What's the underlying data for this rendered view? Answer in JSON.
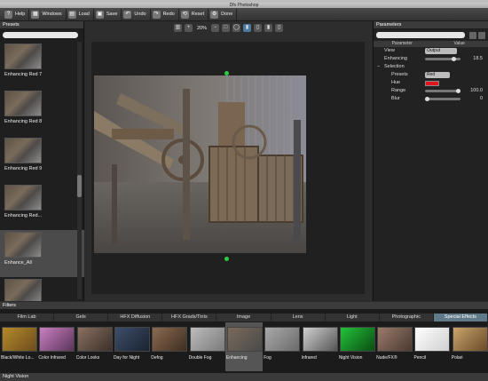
{
  "window": {
    "title": "Dfx Photoshop"
  },
  "toolbar": {
    "buttons": [
      {
        "name": "help-button",
        "icon": "question-icon",
        "glyph": "?",
        "label": "Help"
      },
      {
        "name": "windows-button",
        "icon": "windows-icon",
        "glyph": "▦",
        "label": "Windows"
      },
      {
        "name": "load-button",
        "icon": "folder-icon",
        "glyph": "▤",
        "label": "Load"
      },
      {
        "name": "save-button",
        "icon": "disk-icon",
        "glyph": "▣",
        "label": "Save"
      },
      {
        "name": "undo-button",
        "icon": "undo-icon",
        "glyph": "↶",
        "label": "Undo"
      },
      {
        "name": "redo-button",
        "icon": "redo-icon",
        "glyph": "↷",
        "label": "Redo"
      },
      {
        "name": "reset-button",
        "icon": "reset-icon",
        "glyph": "⟲",
        "label": "Reset"
      },
      {
        "name": "done-button",
        "icon": "gear-icon",
        "glyph": "⚙",
        "label": "Done"
      }
    ]
  },
  "presets": {
    "title": "Presets",
    "items": [
      {
        "label": "Enhancing Red 7"
      },
      {
        "label": "Enhancing Red 8"
      },
      {
        "label": "Enhancing Red 9"
      },
      {
        "label": "Enhancing Red..."
      },
      {
        "label": "Enhance_All"
      },
      {
        "label": ""
      }
    ]
  },
  "view": {
    "zoom": "20%"
  },
  "parameters": {
    "title": "Parameters",
    "col_parameter": "Parameter",
    "col_value": "Value",
    "view_label": "View",
    "view_value": "Output",
    "enhancing_label": "Enhancing",
    "enhancing_value": "18.5",
    "selection_label": "Selection",
    "presets_label": "Presets",
    "presets_value": "Red",
    "hue_label": "Hue",
    "hue_color": "#e0141e",
    "range_label": "Range",
    "range_value": "100.0",
    "blur_label": "Blur",
    "blur_value": "0"
  },
  "filters": {
    "title": "Filters",
    "tabs": [
      "Film Lab",
      "Gels",
      "HFX Diffusion",
      "HFX Grads/Tints",
      "Image",
      "Lens",
      "Light",
      "Photographic",
      "Special Effects"
    ],
    "active_tab": "Special Effects",
    "items": [
      {
        "label": "Black/White Lo...",
        "bg": "linear-gradient(135deg,#b58a2a,#6b4c1e)"
      },
      {
        "label": "Color Infrared",
        "bg": "linear-gradient(135deg,#c97fc2,#5a3558)"
      },
      {
        "label": "Color Looks",
        "bg": "linear-gradient(135deg,#8a7060,#3a302a)"
      },
      {
        "label": "Day for Night",
        "bg": "linear-gradient(135deg,#3d4f6a,#1b2230)"
      },
      {
        "label": "Defog",
        "bg": "linear-gradient(135deg,#8c6a50,#3d2e22)"
      },
      {
        "label": "Double Fog",
        "bg": "linear-gradient(135deg,#bcbcbc,#7a7a7a)"
      },
      {
        "label": "Enhancing",
        "bg": "linear-gradient(135deg,#7a6a5a,#4a4a4a)"
      },
      {
        "label": "Fog",
        "bg": "linear-gradient(135deg,#a9a9a9,#6a6a6a)"
      },
      {
        "label": "Infrared",
        "bg": "linear-gradient(135deg,#d0d0d0,#555)"
      },
      {
        "label": "Night Vision",
        "bg": "linear-gradient(135deg,#23c23a,#0b4d12)"
      },
      {
        "label": "Nude/FX®",
        "bg": "linear-gradient(135deg,#9a7a6a,#4a3a32)"
      },
      {
        "label": "Pencil",
        "bg": "linear-gradient(135deg,#ffffff,#cfcfcf)"
      },
      {
        "label": "Polari",
        "bg": "linear-gradient(135deg,#c9a46a,#6a4a2a)"
      }
    ]
  },
  "status": {
    "text": "Night Vision"
  }
}
